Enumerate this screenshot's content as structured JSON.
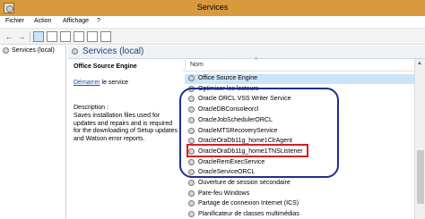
{
  "window": {
    "title": "Services"
  },
  "menu": [
    "Fichier",
    "Action",
    "Affichage",
    "?"
  ],
  "toolbar": {
    "buttons": [
      "back-arrow-icon",
      "forward-arrow-icon",
      "console-tree-icon",
      "console-view-icon",
      "refresh-icon",
      "properties-icon",
      "help-icon",
      "extended-view-icon"
    ]
  },
  "tree": {
    "root_label": "Services (local)"
  },
  "header": {
    "title": "Services (local)"
  },
  "detail": {
    "service_name": "Office Source Engine",
    "start_link": "Démarrer",
    "start_suffix": " le service",
    "description_label": "Description :",
    "description_text": "Saves installation files used for updates and repairs and is required for the downloading of Setup updates and Watson error reports."
  },
  "list": {
    "column_name": "Nom",
    "selected_index": 0,
    "highlighted_index": 8,
    "services": [
      "Office Source Engine",
      "Optimiser les lecteurs",
      "Oracle ORCL VSS Writer Service",
      "OracleDBConsoleorcl",
      "OracleJobSchedulerORCL",
      "OracleMTSRecoveryService",
      "OracleOraDb11g_home1ClrAgent",
      "OracleOraDb11g_home1TNSListener",
      "OracleRemExecService",
      "OracleServiceORCL",
      "Ouverture de session secondaire",
      "Pare-feu Windows",
      "Partage de connexion Internet (ICS)",
      "Planificateur de classes multimédias"
    ]
  },
  "colors": {
    "titlebar": "#d99a3e",
    "selection": "#cce4f7",
    "annotation_oval": "#1c2f8f",
    "annotation_box": "#d42020"
  }
}
